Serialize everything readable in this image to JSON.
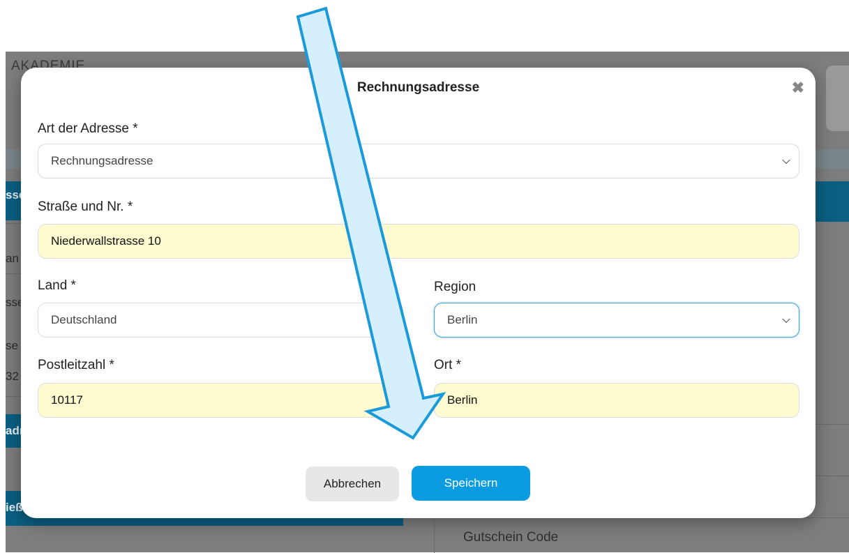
{
  "background": {
    "brand": "AKADEMIE",
    "fragments": [
      "sse",
      "an",
      "sse",
      "se",
      "32",
      "adr",
      "ieß"
    ],
    "gutschein_label": "Gutschein Code"
  },
  "modal": {
    "title": "Rechnungsadresse",
    "close_symbol": "✖",
    "address_type": {
      "label": "Art der Adresse *",
      "value": "Rechnungsadresse"
    },
    "street": {
      "label": "Straße und Nr. *",
      "value": "Niederwallstrasse 10"
    },
    "country": {
      "label": "Land *",
      "value": "Deutschland"
    },
    "region": {
      "label": "Region",
      "value": "Berlin"
    },
    "postcode": {
      "label": "Postleitzahl *",
      "value": "10117"
    },
    "city": {
      "label": "Ort *",
      "value": "Berlin"
    },
    "cancel_label": "Abbrechen",
    "save_label": "Speichern"
  },
  "colors": {
    "accent": "#0a9be0",
    "filled_field": "#fffbd0",
    "arrow_fill": "#d6effc",
    "arrow_stroke": "#1a9ad8"
  },
  "icons": {
    "close": "close-icon",
    "dropdown": "chevron-down-icon",
    "annotation": "arrow-annotation"
  }
}
